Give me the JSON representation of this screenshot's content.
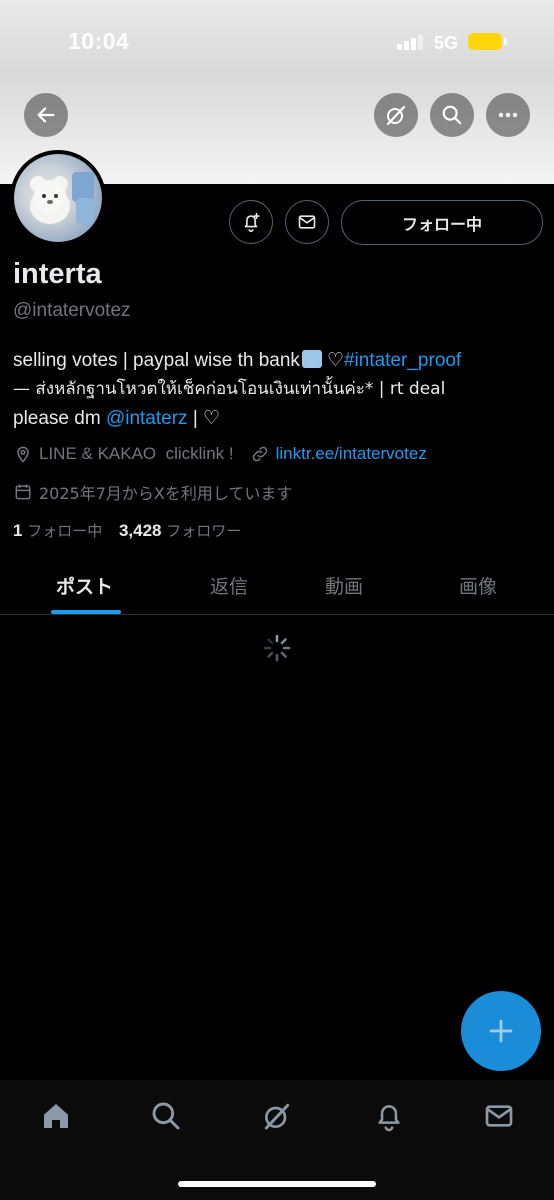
{
  "status_bar": {
    "time": "10:04",
    "network": "5G"
  },
  "profile": {
    "name": "interta",
    "handle": "@intatervotez",
    "follow_button_label": "フォロー中",
    "bio": {
      "line1_text": "selling votes | paypal wise th bank",
      "line1_heart": "♡",
      "line1_hashtag": "#intater_proof",
      "line2": "— ส่งหลักฐานโหวตให้เช็คก่อนโอนเงินเท่านั้นค่ะ* | rt deal",
      "line3_prefix": "please dm ",
      "line3_mention": "@intaterz",
      "line3_suffix": " | ♡"
    },
    "location": "LINE & KAKAO  clicklink !",
    "website": "linktr.ee/intatervotez",
    "joined": "2025年7月からXを利用しています",
    "following_count": "1",
    "following_label": "フォロー中",
    "followers_count": "3,428",
    "followers_label": "フォロワー"
  },
  "tabs": [
    {
      "label": "ポスト",
      "active": true
    },
    {
      "label": "返信",
      "active": false
    },
    {
      "label": "動画",
      "active": false
    },
    {
      "label": "画像",
      "active": false
    }
  ],
  "icons": {
    "header": [
      "back-arrow-icon",
      "grok-icon",
      "search-icon",
      "more-icon"
    ],
    "profile_actions": [
      "notification-bell-plus-icon",
      "mail-icon"
    ],
    "bottom_nav": [
      "home-icon",
      "search-icon",
      "grok-icon",
      "notifications-icon",
      "messages-icon"
    ],
    "fab": "plus-icon"
  },
  "colors": {
    "accent": "#1d9bf0",
    "background": "#000000",
    "secondary_text": "#71767b",
    "battery": "#ffd60a"
  }
}
